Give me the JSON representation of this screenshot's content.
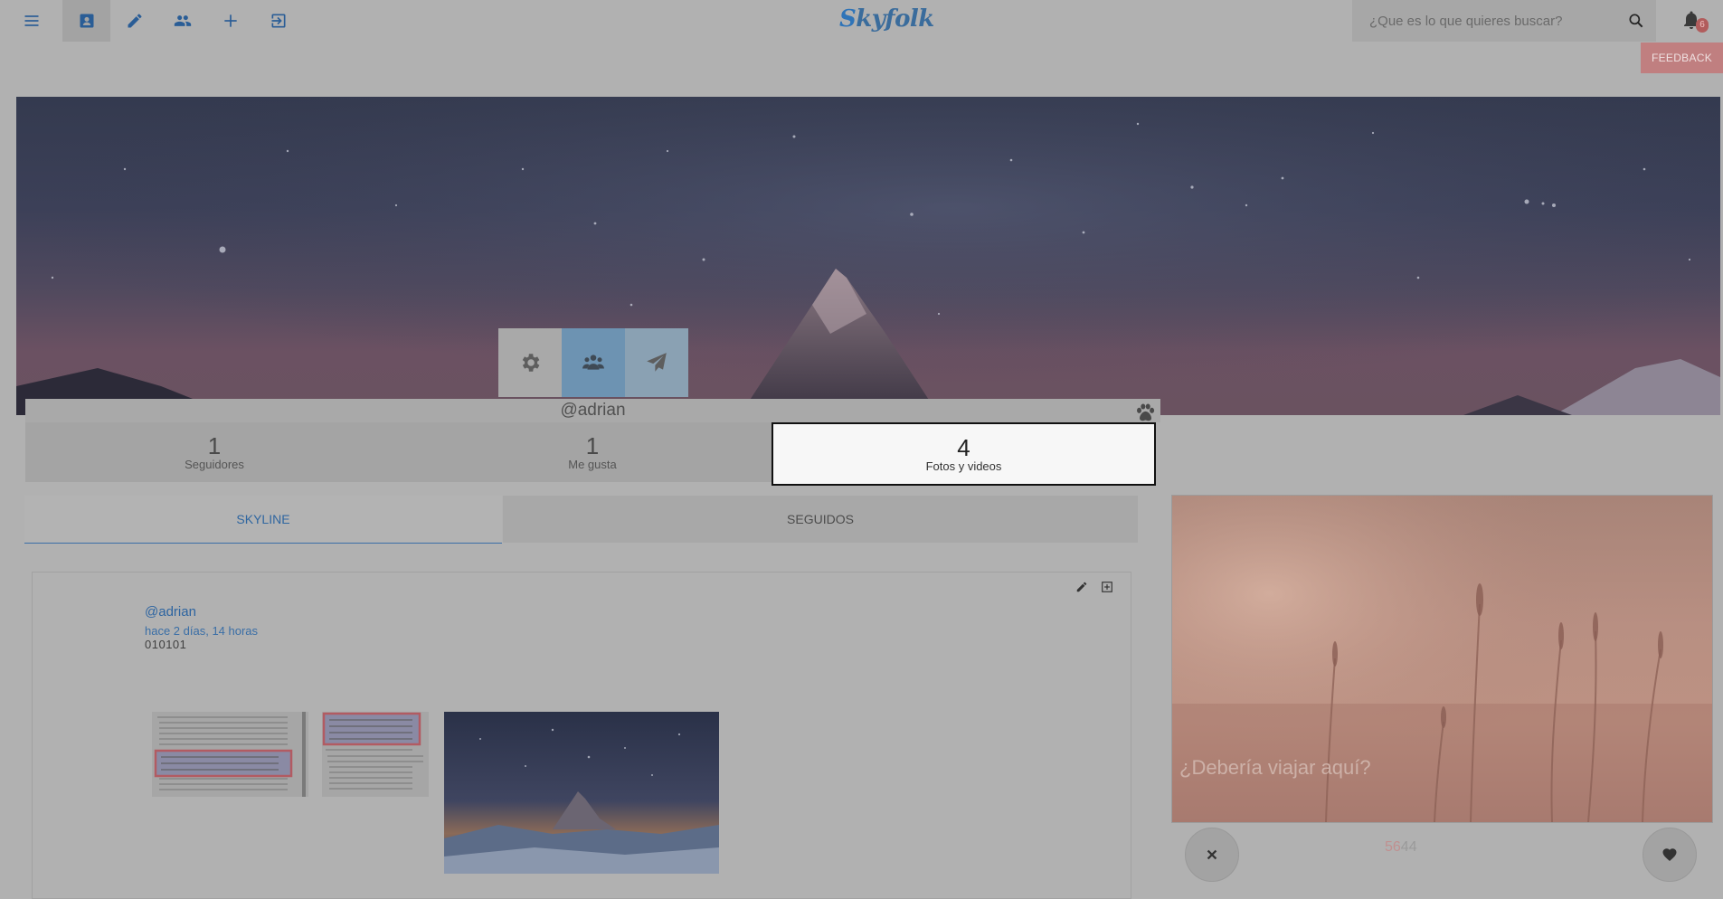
{
  "brand": {
    "logo": "Skyfolk"
  },
  "nav": {
    "items": [
      {
        "name": "menu-button",
        "icon": "menu-icon"
      },
      {
        "name": "profile-button",
        "icon": "profile-card-icon",
        "active": true
      },
      {
        "name": "write-button",
        "icon": "pencil-icon"
      },
      {
        "name": "friends-button",
        "icon": "people-icon"
      },
      {
        "name": "add-button",
        "icon": "plus-icon"
      },
      {
        "name": "logout-button",
        "icon": "logout-icon"
      }
    ]
  },
  "search": {
    "placeholder": "¿Que es lo que quieres buscar?"
  },
  "notifications": {
    "count": "6"
  },
  "feedback_label": "FEEDBACK",
  "profile": {
    "username": "@adrian",
    "actions": [
      "gear-icon",
      "users-icon",
      "paper-plane-icon"
    ],
    "stats": [
      {
        "value": "1",
        "label": "Seguidores"
      },
      {
        "value": "1",
        "label": "Me gusta"
      },
      {
        "value": "4",
        "label": "Fotos y videos"
      }
    ]
  },
  "tabs": [
    {
      "label": "SKYLINE",
      "active": true
    },
    {
      "label": "SEGUIDOS",
      "active": false
    }
  ],
  "post": {
    "author": "@adrian",
    "time": "hace 2 días, 14 horas",
    "text": "010101"
  },
  "promo": {
    "question": "¿Debería viajar aquí?",
    "votes_up": "56",
    "votes_down": "44"
  },
  "colors": {
    "accent": "#2f66a0",
    "badge": "#b15c5c",
    "feedback": "#c07f80"
  }
}
